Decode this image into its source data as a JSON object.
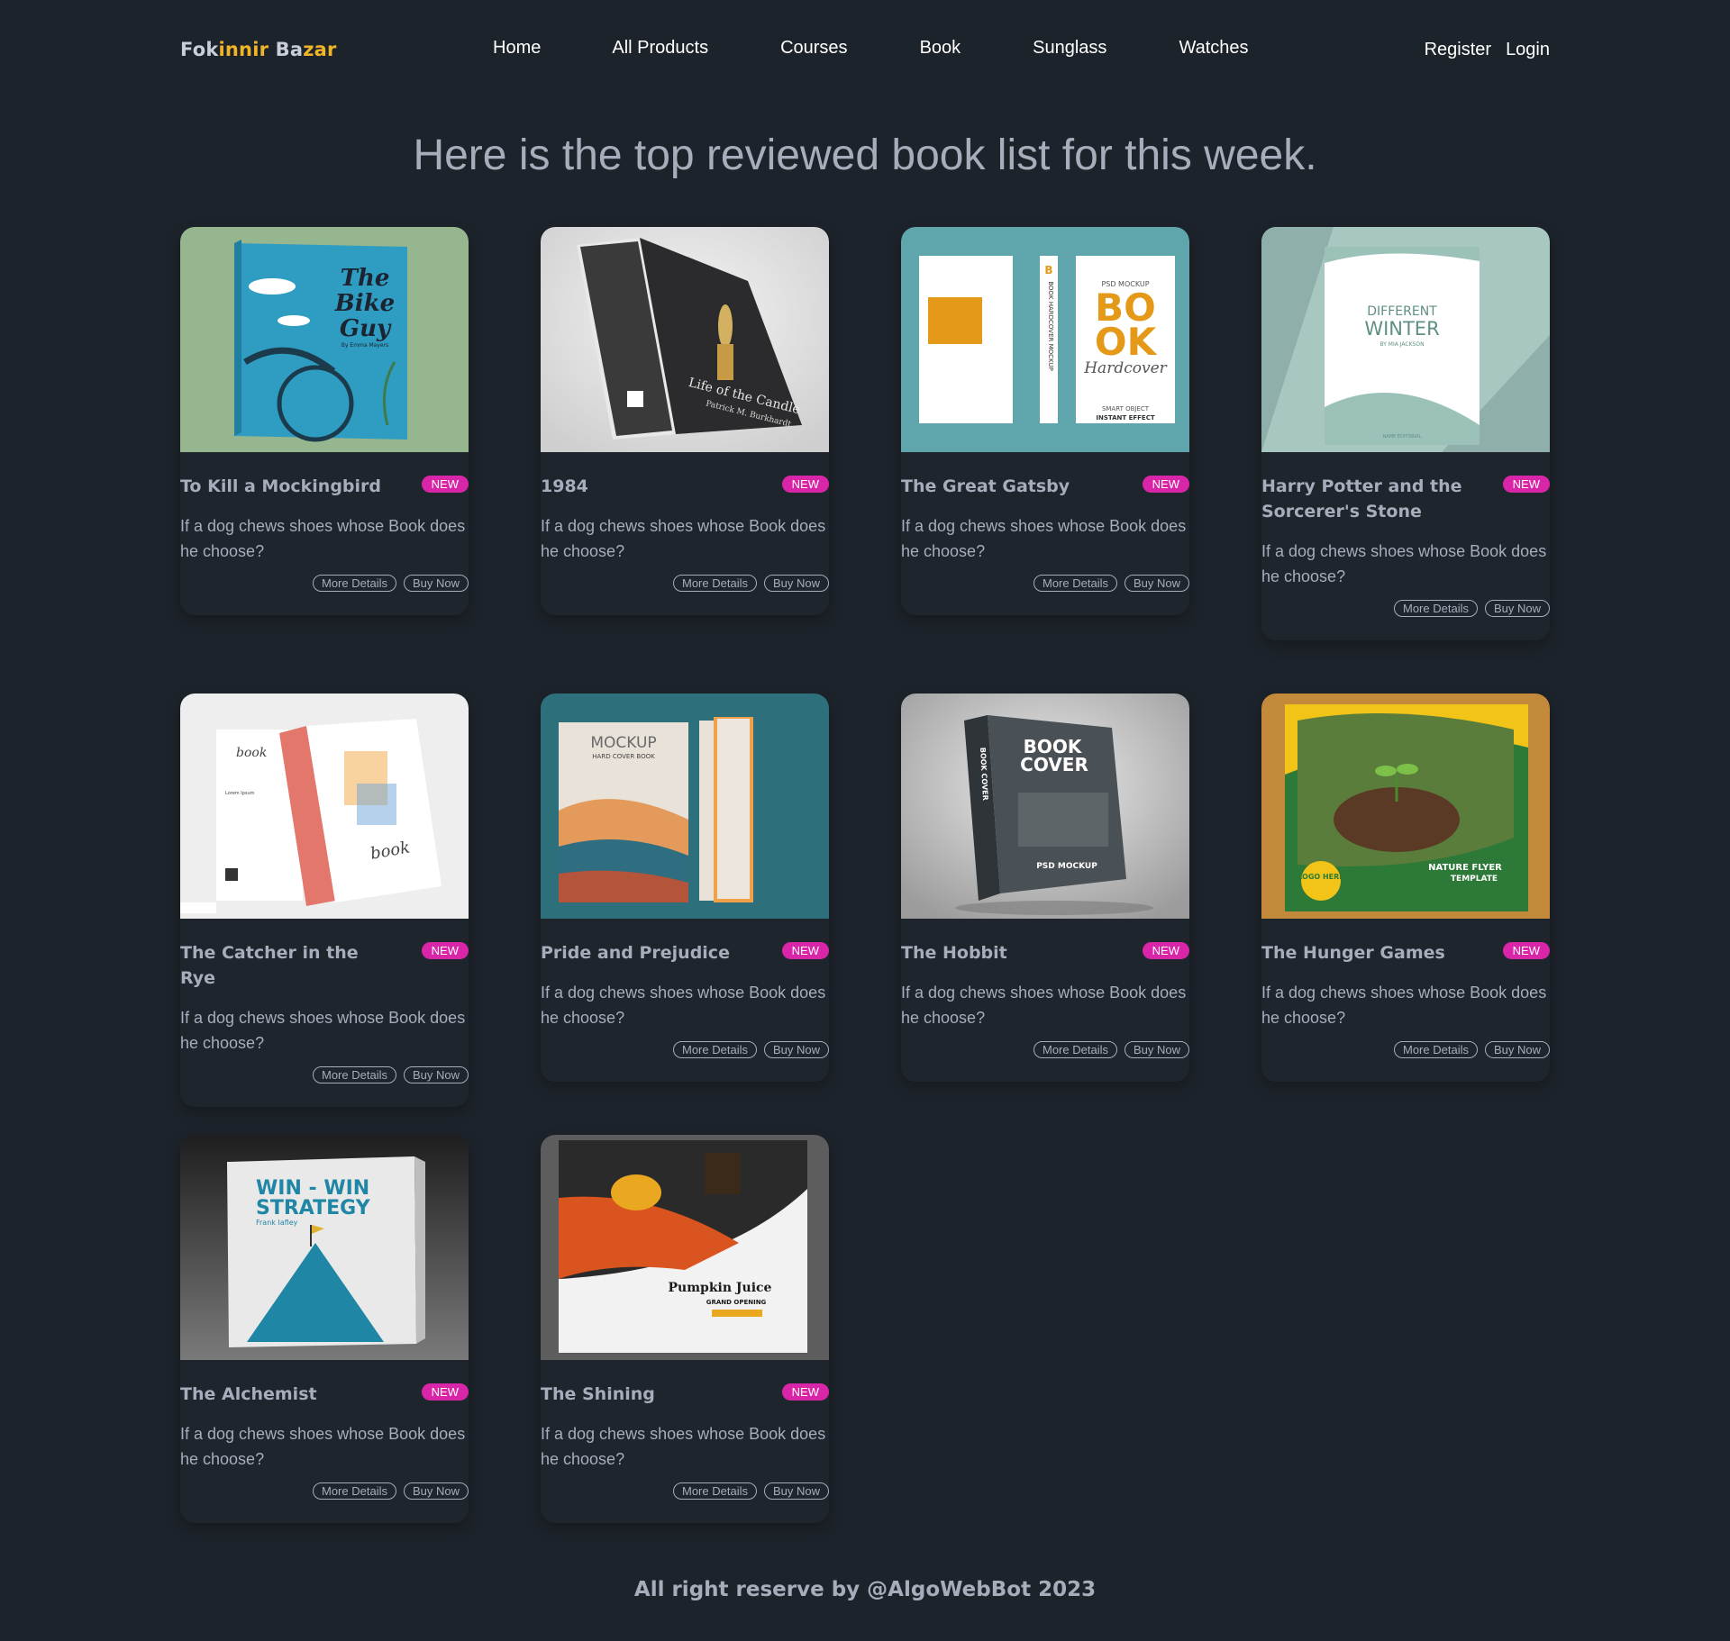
{
  "brand": {
    "part1": "Fok",
    "part2": "innir",
    "part3": " Ba",
    "part4": "zar"
  },
  "nav": {
    "links": [
      "Home",
      "All Products",
      "Courses",
      "Book",
      "Sunglass",
      "Watches"
    ],
    "register": "Register",
    "login": "Login"
  },
  "headline": "Here is the top reviewed book list for this week.",
  "cards": [
    {
      "title": "To Kill a Mockingbird",
      "badge": "NEW",
      "desc": "If a dog chews shoes whose Book does he choose?",
      "more": "More Details",
      "buy": "Buy Now"
    },
    {
      "title": "1984",
      "badge": "NEW",
      "desc": "If a dog chews shoes whose Book does he choose?",
      "more": "More Details",
      "buy": "Buy Now"
    },
    {
      "title": "The Great Gatsby",
      "badge": "NEW",
      "desc": "If a dog chews shoes whose Book does he choose?",
      "more": "More Details",
      "buy": "Buy Now"
    },
    {
      "title": "Harry Potter and the Sorcerer's Stone",
      "badge": "NEW",
      "desc": "If a dog chews shoes whose Book does he choose?",
      "more": "More Details",
      "buy": "Buy Now"
    },
    {
      "title": "The Catcher in the Rye",
      "badge": "NEW",
      "desc": "If a dog chews shoes whose Book does he choose?",
      "more": "More Details",
      "buy": "Buy Now"
    },
    {
      "title": "Pride and Prejudice",
      "badge": "NEW",
      "desc": "If a dog chews shoes whose Book does he choose?",
      "more": "More Details",
      "buy": "Buy Now"
    },
    {
      "title": "The Hobbit",
      "badge": "NEW",
      "desc": "If a dog chews shoes whose Book does he choose?",
      "more": "More Details",
      "buy": "Buy Now"
    },
    {
      "title": "The Hunger Games",
      "badge": "NEW",
      "desc": "If a dog chews shoes whose Book does he choose?",
      "more": "More Details",
      "buy": "Buy Now"
    },
    {
      "title": "The Alchemist",
      "badge": "NEW",
      "desc": "If a dog chews shoes whose Book does he choose?",
      "more": "More Details",
      "buy": "Buy Now"
    },
    {
      "title": "The Shining",
      "badge": "NEW",
      "desc": "If a dog chews shoes whose Book does he choose?",
      "more": "More Details",
      "buy": "Buy Now"
    }
  ],
  "covers": [
    {
      "lines": [
        "The",
        "Bike",
        "Guy"
      ],
      "sub": "By Emma Mayers"
    },
    {
      "lines": [
        "Life of the Candle"
      ],
      "sub": "Patrick M. Burkhardt"
    },
    {
      "lines": [
        "BO",
        "OK"
      ],
      "sub": "Hardcover",
      "extra": "PSD MOCKUP",
      "extra2": "SMART OBJECT",
      "extra3": "INSTANT EFFECT",
      "spine": "BOOK HARDCOVER MOCKUP"
    },
    {
      "lines": [
        "DIFFERENT",
        "WINTER"
      ],
      "sub": "BY MIA JACKSON",
      "extra": "NAME EDITORIAL"
    },
    {
      "lines": [
        "book"
      ],
      "sub": "Lorem Ipsum"
    },
    {
      "lines": [
        "MOCKUP"
      ],
      "sub": "HARD COVER BOOK"
    },
    {
      "lines": [
        "BOOK",
        "COVER"
      ],
      "sub": "PSD MOCKUP",
      "spine": "BOOK COVER"
    },
    {
      "lines": [
        "NATURE FLYER",
        "TEMPLATE"
      ],
      "sub": "LOGO HERE"
    },
    {
      "lines": [
        "WIN - WIN",
        "STRATEGY"
      ],
      "sub": "Frank Iafley"
    },
    {
      "lines": [
        "Pumpkin Juice"
      ],
      "sub": "GRAND OPENING"
    }
  ],
  "footer": "All right reserve by @AlgoWebBot 2023",
  "colors": {
    "bg": "#1d232a",
    "badge": "#d926a9",
    "brand_accent": "#f0b429"
  }
}
